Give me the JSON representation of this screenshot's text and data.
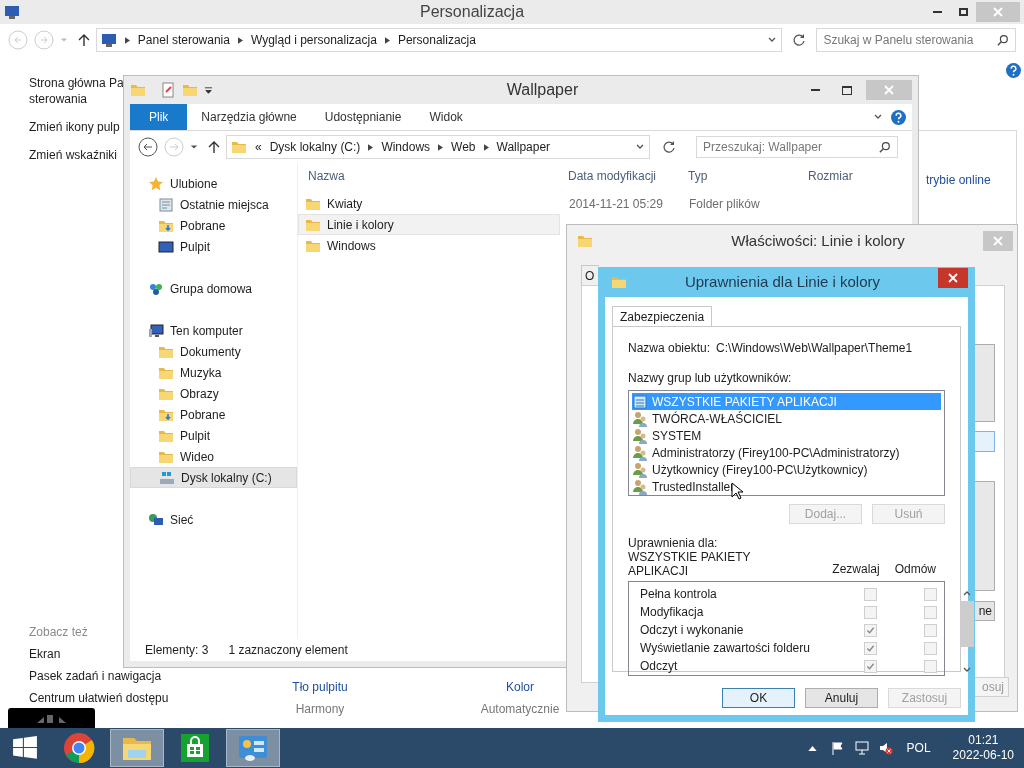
{
  "control_panel": {
    "title": "Personalizacja",
    "breadcrumb": [
      "Panel sterowania",
      "Wygląd i personalizacja",
      "Personalizacja"
    ],
    "search_placeholder": "Szukaj w Panelu sterowania",
    "sidebar_links": [
      {
        "lines": [
          "Strona główna Pa",
          "sterowania"
        ]
      },
      {
        "lines": [
          "Zmień ikony pulp"
        ]
      },
      {
        "lines": [
          "Zmień wskaźniki"
        ]
      }
    ],
    "see_also": {
      "title": "Zobacz też",
      "items": [
        "Ekran",
        "Pasek zadań i nawigacja",
        "Centrum ułatwień dostępu"
      ]
    },
    "right_link": "trybie online",
    "bottom_items": [
      {
        "label": "Tło pulpitu",
        "value": "Harmony"
      },
      {
        "label": "Kolor",
        "value": "Automatycznie"
      }
    ]
  },
  "explorer": {
    "title": "Wallpaper",
    "ribbon_tabs": [
      {
        "label": "Plik",
        "kind": "file"
      },
      {
        "label": "Narzędzia główne",
        "kind": "tab"
      },
      {
        "label": "Udostępnianie",
        "kind": "tab"
      },
      {
        "label": "Widok",
        "kind": "tab"
      }
    ],
    "path": [
      "Dysk lokalny (C:)",
      "Windows",
      "Web",
      "Wallpaper"
    ],
    "path_prefix": "«",
    "search_placeholder": "Przeszukaj: Wallpaper",
    "nav": [
      {
        "label": "Ulubione",
        "kind": "star",
        "selected": false,
        "children": [
          {
            "label": "Ostatnie miejsca",
            "kind": "recent",
            "selected": false
          },
          {
            "label": "Pobrane",
            "kind": "download",
            "selected": false
          },
          {
            "label": "Pulpit",
            "kind": "desktop",
            "selected": false
          }
        ]
      },
      {
        "label": "Grupa domowa",
        "kind": "homegroup",
        "selected": false
      },
      {
        "label": "Ten komputer",
        "kind": "computer",
        "selected": false,
        "children": [
          {
            "label": "Dokumenty",
            "kind": "folder",
            "selected": false
          },
          {
            "label": "Muzyka",
            "kind": "folder",
            "selected": false
          },
          {
            "label": "Obrazy",
            "kind": "folder",
            "selected": false
          },
          {
            "label": "Pobrane",
            "kind": "download",
            "selected": false
          },
          {
            "label": "Pulpit",
            "kind": "folder",
            "selected": false
          },
          {
            "label": "Wideo",
            "kind": "folder",
            "selected": false
          },
          {
            "label": "Dysk lokalny (C:)",
            "kind": "drive",
            "selected": true
          }
        ]
      },
      {
        "label": "Sieć",
        "kind": "network",
        "selected": false
      }
    ],
    "columns": [
      "Nazwa",
      "Data modyfikacji",
      "Typ",
      "Rozmiar"
    ],
    "rows": [
      {
        "name": "Kwiaty",
        "date": "2014-11-21 05:29",
        "type": "Folder plików",
        "selected": false
      },
      {
        "name": "Linie i kolory",
        "selected": true
      },
      {
        "name": "Windows",
        "selected": false
      }
    ],
    "status": [
      "Elementy: 3",
      "1 zaznaczony element"
    ]
  },
  "properties": {
    "title": "Właściwości: Linie i kolory",
    "tab_fragment": "O",
    "button_fragments": [
      "ne",
      "osuj"
    ]
  },
  "permissions": {
    "title": "Uprawnienia dla Linie i kolory",
    "tab": "Zabezpieczenia",
    "object_label": "Nazwa obiektu:",
    "object_value": "C:\\Windows\\Web\\Wallpaper\\Theme1",
    "groups_label": "Nazwy grup lub użytkowników:",
    "principals": [
      {
        "name": "WSZYSTKIE PAKIETY APLIKACJI",
        "kind": "package",
        "selected": true
      },
      {
        "name": "TWÓRCA-WŁAŚCICIEL",
        "kind": "group",
        "selected": false
      },
      {
        "name": "SYSTEM",
        "kind": "group",
        "selected": false
      },
      {
        "name": "Administratorzy (Firey100-PC\\Administratorzy)",
        "kind": "group",
        "selected": false
      },
      {
        "name": "Użytkownicy (Firey100-PC\\Użytkownicy)",
        "kind": "group",
        "selected": false
      },
      {
        "name": "TrustedInstaller",
        "kind": "group",
        "selected": false
      }
    ],
    "list_buttons": [
      {
        "label": "Dodaj...",
        "disabled": true
      },
      {
        "label": "Usuń",
        "disabled": true
      }
    ],
    "perms_label": "Uprawnienia dla: WSZYSTKIE PAKIETY APLIKACJI",
    "allow_header": "Zezwalaj",
    "deny_header": "Odmów",
    "perms": [
      {
        "name": "Pełna kontrola",
        "allow": false,
        "deny": false
      },
      {
        "name": "Modyfikacja",
        "allow": false,
        "deny": false
      },
      {
        "name": "Odczyt i wykonanie",
        "allow": true,
        "deny": false
      },
      {
        "name": "Wyświetlanie zawartości folderu",
        "allow": true,
        "deny": false
      },
      {
        "name": "Odczyt",
        "allow": true,
        "deny": false
      }
    ],
    "buttons": [
      {
        "label": "OK",
        "disabled": false,
        "default": true
      },
      {
        "label": "Anuluj",
        "disabled": false,
        "default": false
      },
      {
        "label": "Zastosuj",
        "disabled": true,
        "default": false
      }
    ]
  },
  "taskbar": {
    "apps": [
      {
        "kind": "chrome",
        "active": false
      },
      {
        "kind": "explorer",
        "active": true
      },
      {
        "kind": "store",
        "active": false
      },
      {
        "kind": "control",
        "active": true
      }
    ],
    "language": "POL",
    "time": "01:21",
    "date": "2022-06-10"
  }
}
